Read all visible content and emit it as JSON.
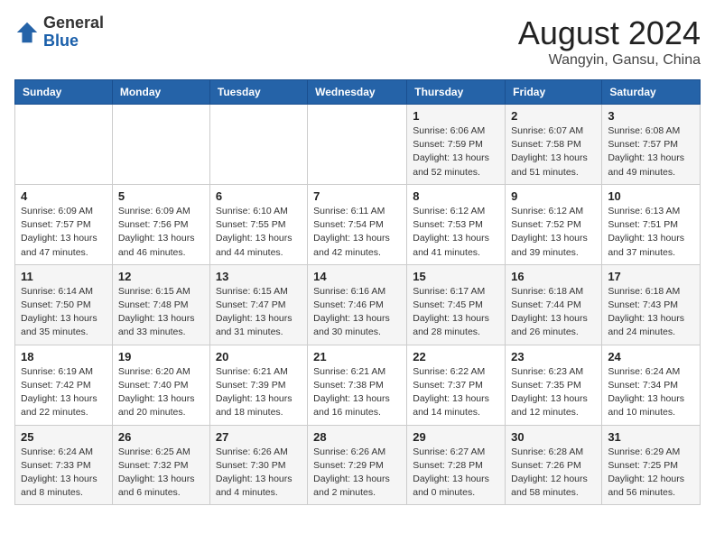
{
  "header": {
    "logo_general": "General",
    "logo_blue": "Blue",
    "month_year": "August 2024",
    "location": "Wangyin, Gansu, China"
  },
  "weekdays": [
    "Sunday",
    "Monday",
    "Tuesday",
    "Wednesday",
    "Thursday",
    "Friday",
    "Saturday"
  ],
  "weeks": [
    [
      {
        "day": "",
        "info": ""
      },
      {
        "day": "",
        "info": ""
      },
      {
        "day": "",
        "info": ""
      },
      {
        "day": "",
        "info": ""
      },
      {
        "day": "1",
        "info": "Sunrise: 6:06 AM\nSunset: 7:59 PM\nDaylight: 13 hours\nand 52 minutes."
      },
      {
        "day": "2",
        "info": "Sunrise: 6:07 AM\nSunset: 7:58 PM\nDaylight: 13 hours\nand 51 minutes."
      },
      {
        "day": "3",
        "info": "Sunrise: 6:08 AM\nSunset: 7:57 PM\nDaylight: 13 hours\nand 49 minutes."
      }
    ],
    [
      {
        "day": "4",
        "info": "Sunrise: 6:09 AM\nSunset: 7:57 PM\nDaylight: 13 hours\nand 47 minutes."
      },
      {
        "day": "5",
        "info": "Sunrise: 6:09 AM\nSunset: 7:56 PM\nDaylight: 13 hours\nand 46 minutes."
      },
      {
        "day": "6",
        "info": "Sunrise: 6:10 AM\nSunset: 7:55 PM\nDaylight: 13 hours\nand 44 minutes."
      },
      {
        "day": "7",
        "info": "Sunrise: 6:11 AM\nSunset: 7:54 PM\nDaylight: 13 hours\nand 42 minutes."
      },
      {
        "day": "8",
        "info": "Sunrise: 6:12 AM\nSunset: 7:53 PM\nDaylight: 13 hours\nand 41 minutes."
      },
      {
        "day": "9",
        "info": "Sunrise: 6:12 AM\nSunset: 7:52 PM\nDaylight: 13 hours\nand 39 minutes."
      },
      {
        "day": "10",
        "info": "Sunrise: 6:13 AM\nSunset: 7:51 PM\nDaylight: 13 hours\nand 37 minutes."
      }
    ],
    [
      {
        "day": "11",
        "info": "Sunrise: 6:14 AM\nSunset: 7:50 PM\nDaylight: 13 hours\nand 35 minutes."
      },
      {
        "day": "12",
        "info": "Sunrise: 6:15 AM\nSunset: 7:48 PM\nDaylight: 13 hours\nand 33 minutes."
      },
      {
        "day": "13",
        "info": "Sunrise: 6:15 AM\nSunset: 7:47 PM\nDaylight: 13 hours\nand 31 minutes."
      },
      {
        "day": "14",
        "info": "Sunrise: 6:16 AM\nSunset: 7:46 PM\nDaylight: 13 hours\nand 30 minutes."
      },
      {
        "day": "15",
        "info": "Sunrise: 6:17 AM\nSunset: 7:45 PM\nDaylight: 13 hours\nand 28 minutes."
      },
      {
        "day": "16",
        "info": "Sunrise: 6:18 AM\nSunset: 7:44 PM\nDaylight: 13 hours\nand 26 minutes."
      },
      {
        "day": "17",
        "info": "Sunrise: 6:18 AM\nSunset: 7:43 PM\nDaylight: 13 hours\nand 24 minutes."
      }
    ],
    [
      {
        "day": "18",
        "info": "Sunrise: 6:19 AM\nSunset: 7:42 PM\nDaylight: 13 hours\nand 22 minutes."
      },
      {
        "day": "19",
        "info": "Sunrise: 6:20 AM\nSunset: 7:40 PM\nDaylight: 13 hours\nand 20 minutes."
      },
      {
        "day": "20",
        "info": "Sunrise: 6:21 AM\nSunset: 7:39 PM\nDaylight: 13 hours\nand 18 minutes."
      },
      {
        "day": "21",
        "info": "Sunrise: 6:21 AM\nSunset: 7:38 PM\nDaylight: 13 hours\nand 16 minutes."
      },
      {
        "day": "22",
        "info": "Sunrise: 6:22 AM\nSunset: 7:37 PM\nDaylight: 13 hours\nand 14 minutes."
      },
      {
        "day": "23",
        "info": "Sunrise: 6:23 AM\nSunset: 7:35 PM\nDaylight: 13 hours\nand 12 minutes."
      },
      {
        "day": "24",
        "info": "Sunrise: 6:24 AM\nSunset: 7:34 PM\nDaylight: 13 hours\nand 10 minutes."
      }
    ],
    [
      {
        "day": "25",
        "info": "Sunrise: 6:24 AM\nSunset: 7:33 PM\nDaylight: 13 hours\nand 8 minutes."
      },
      {
        "day": "26",
        "info": "Sunrise: 6:25 AM\nSunset: 7:32 PM\nDaylight: 13 hours\nand 6 minutes."
      },
      {
        "day": "27",
        "info": "Sunrise: 6:26 AM\nSunset: 7:30 PM\nDaylight: 13 hours\nand 4 minutes."
      },
      {
        "day": "28",
        "info": "Sunrise: 6:26 AM\nSunset: 7:29 PM\nDaylight: 13 hours\nand 2 minutes."
      },
      {
        "day": "29",
        "info": "Sunrise: 6:27 AM\nSunset: 7:28 PM\nDaylight: 13 hours\nand 0 minutes."
      },
      {
        "day": "30",
        "info": "Sunrise: 6:28 AM\nSunset: 7:26 PM\nDaylight: 12 hours\nand 58 minutes."
      },
      {
        "day": "31",
        "info": "Sunrise: 6:29 AM\nSunset: 7:25 PM\nDaylight: 12 hours\nand 56 minutes."
      }
    ]
  ]
}
